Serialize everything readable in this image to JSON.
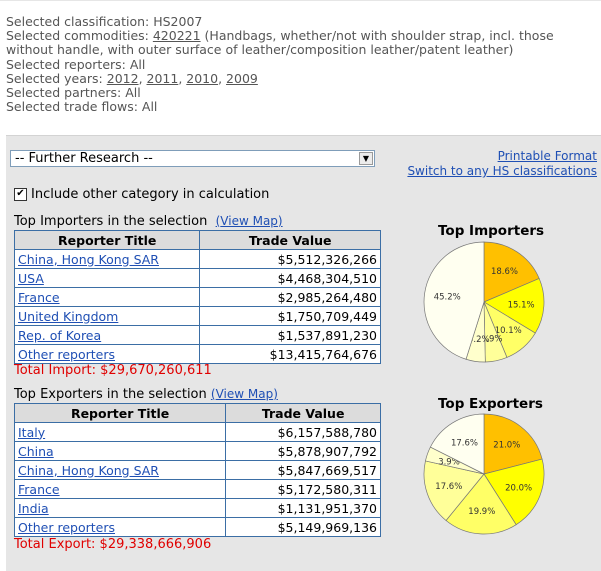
{
  "selection": {
    "classification": "Selected classification: HS2007",
    "commodities_prefix": "Selected commodities: ",
    "commodity_code": "420221",
    "commodity_desc_line1": " (Handbags, whether/not with shoulder strap, incl. those",
    "commodity_desc_line2": "without handle, with outer surface of leather/composition leather/patent leather)",
    "reporters": "Selected reporters: All",
    "years_prefix": "Selected years: ",
    "years": [
      "2012",
      "2011",
      "2010",
      "2009"
    ],
    "partners": "Selected partners: All",
    "trade_flows": "Selected trade flows: All"
  },
  "controls": {
    "research_select": "-- Further Research --",
    "printable_format": "Printable Format",
    "switch_hs": "Switch to any HS classifications",
    "include_other": "Include other category in calculation",
    "include_other_checked": "✔"
  },
  "importers": {
    "title": "Top Importers in the selection",
    "map_link_open": "(",
    "map_link": "View Map",
    "map_link_close": ")",
    "col_reporter": "Reporter Title",
    "col_value": "Trade Value",
    "rows": [
      {
        "name": "China, Hong Kong SAR",
        "value": "$5,512,326,266"
      },
      {
        "name": "USA",
        "value": "$4,468,304,510"
      },
      {
        "name": "France",
        "value": "$2,985,264,480"
      },
      {
        "name": "United Kingdom",
        "value": "$1,750,709,449"
      },
      {
        "name": "Rep. of Korea",
        "value": "$1,537,891,230"
      },
      {
        "name": "Other reporters",
        "value": "$13,415,764,676"
      }
    ],
    "total": "Total Import: $29,670,260,611",
    "pie_title": "Top Importers",
    "pie": {
      "labels": [
        "18.6%",
        "15.1%",
        "10.1%",
        "5.9%",
        "5.2%",
        "45.2%"
      ],
      "values": [
        18.6,
        15.1,
        10.1,
        5.9,
        5.2,
        45.2
      ],
      "colors": [
        "#ffc000",
        "#ffff00",
        "#ffff66",
        "#ffff99",
        "#ffffcc",
        "#fffff0"
      ]
    }
  },
  "exporters": {
    "title": "Top Exporters in the selection",
    "map_link_open": "(",
    "map_link": "View Map",
    "map_link_close": ")",
    "col_reporter": "Reporter Title",
    "col_value": "Trade Value",
    "rows": [
      {
        "name": "Italy",
        "value": "$6,157,588,780"
      },
      {
        "name": "China",
        "value": "$5,878,907,792"
      },
      {
        "name": "China, Hong Kong SAR",
        "value": "$5,847,669,517"
      },
      {
        "name": "France",
        "value": "$5,172,580,311"
      },
      {
        "name": "India",
        "value": "$1,131,951,370"
      },
      {
        "name": "Other reporters",
        "value": "$5,149,969,136"
      }
    ],
    "total": "Total Export: $29,338,666,906",
    "pie_title": "Top Exporters",
    "pie": {
      "labels": [
        "21.0%",
        "20.0%",
        "19.9%",
        "17.6%",
        "3.9%",
        "17.6%"
      ],
      "values": [
        21.0,
        20.0,
        19.9,
        17.6,
        3.9,
        17.6
      ],
      "colors": [
        "#ffc000",
        "#ffff00",
        "#ffff66",
        "#ffff99",
        "#ffffcc",
        "#fffff0"
      ]
    }
  }
}
